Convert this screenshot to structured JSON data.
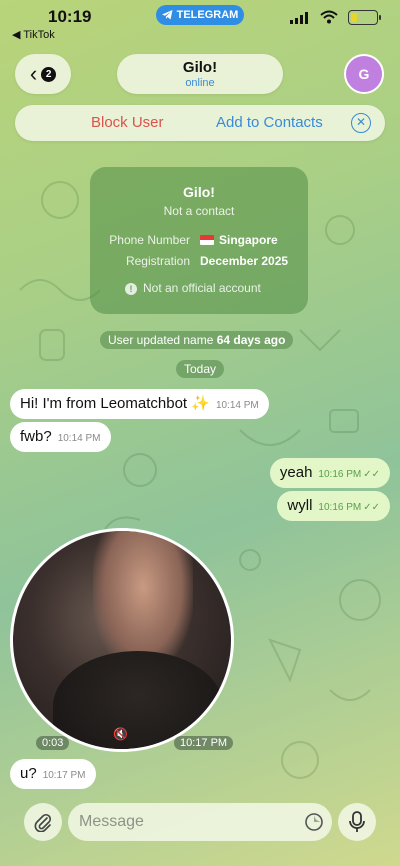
{
  "status_bar": {
    "time": "10:19",
    "back_app": "◀ TikTok",
    "telegram_pill": "TELEGRAM"
  },
  "header": {
    "back_count": "2",
    "contact_name": "Gilo!",
    "contact_status": "online",
    "avatar_letter": "G",
    "avatar_color": "#c080e0"
  },
  "action_bar": {
    "block_label": "Block User",
    "add_label": "Add to Contacts"
  },
  "info_card": {
    "name": "Gilo!",
    "subtitle": "Not a contact",
    "phone_label": "Phone Number",
    "phone_value": "Singapore",
    "registration_label": "Registration",
    "registration_value": "December 2025",
    "note": "Not an official account"
  },
  "system": {
    "name_update_prefix": "User updated name",
    "name_update_bold": "64 days ago",
    "date_divider": "Today"
  },
  "messages": [
    {
      "text": "Hi! I'm from Leomatchbot ✨",
      "time": "10:14 PM",
      "outgoing": false
    },
    {
      "text": "fwb?",
      "time": "10:14 PM",
      "outgoing": false
    },
    {
      "text": "yeah",
      "time": "10:16 PM",
      "outgoing": true
    },
    {
      "text": "wyll",
      "time": "10:16 PM",
      "outgoing": true
    },
    {
      "text": "u?",
      "time": "10:17 PM",
      "outgoing": false
    }
  ],
  "video_message": {
    "duration": "0:03",
    "time": "10:17 PM"
  },
  "composer": {
    "placeholder": "Message"
  }
}
